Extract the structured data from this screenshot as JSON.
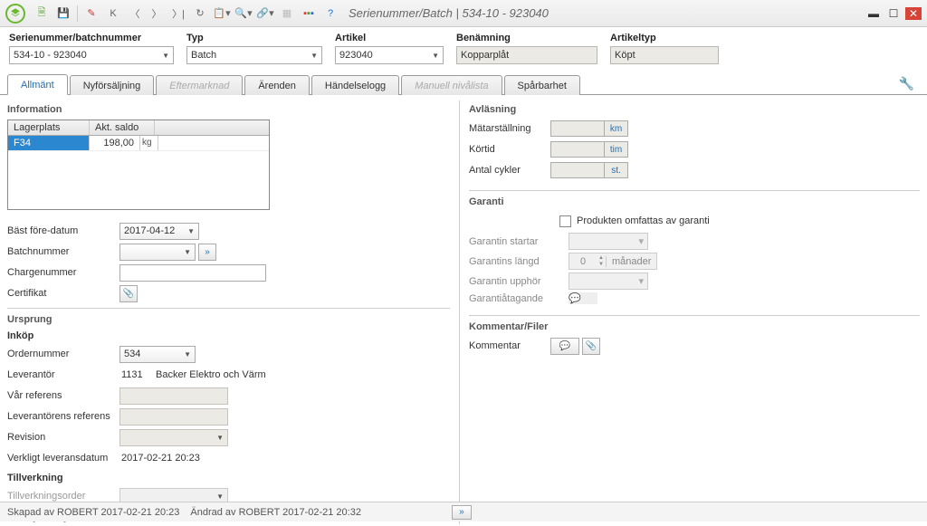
{
  "window": {
    "title": "Serienummer/Batch | 534-10 - 923040"
  },
  "header": {
    "serial_label": "Serienummer/batchnummer",
    "serial_value": "534-10 - 923040",
    "type_label": "Typ",
    "type_value": "Batch",
    "article_label": "Artikel",
    "article_value": "923040",
    "name_label": "Benämning",
    "name_value": "Kopparplåt",
    "arttype_label": "Artikeltyp",
    "arttype_value": "Köpt"
  },
  "tabs": {
    "t0": "Allmänt",
    "t1": "Nyförsäljning",
    "t2": "Eftermarknad",
    "t3": "Ärenden",
    "t4": "Händelselogg",
    "t5": "Manuell nivålista",
    "t6": "Spårbarhet"
  },
  "info": {
    "title": "Information",
    "col1": "Lagerplats",
    "col2": "Akt. saldo",
    "row1_place": "F34",
    "row1_qty": "198,00",
    "row1_unit": "kg",
    "best_before_label": "Bäst före-datum",
    "best_before_value": "2017-04-12",
    "batchnum_label": "Batchnummer",
    "chargenum_label": "Chargenummer",
    "cert_label": "Certifikat"
  },
  "origin": {
    "title": "Ursprung",
    "purchase_title": "Inköp",
    "order_label": "Ordernummer",
    "order_value": "534",
    "supplier_label": "Leverantör",
    "supplier_code": "1131",
    "supplier_name": "Backer Elektro och Värm",
    "ourref_label": "Vår referens",
    "supref_label": "Leverantörens referens",
    "revision_label": "Revision",
    "delivery_label": "Verkligt leveransdatum",
    "delivery_value": "2017-02-21 20:23",
    "mfg_title": "Tillverkning",
    "mfgorder_label": "Tillverkningsorder",
    "finished_label": "Verkligt färdigdatum"
  },
  "reading": {
    "title": "Avläsning",
    "meter_label": "Mätarställning",
    "meter_unit": "km",
    "runtime_label": "Körtid",
    "runtime_unit": "tim",
    "cycles_label": "Antal cykler",
    "cycles_unit": "st."
  },
  "warranty": {
    "title": "Garanti",
    "checkbox_label": "Produkten omfattas av garanti",
    "start_label": "Garantin startar",
    "length_label": "Garantins längd",
    "length_value": "0",
    "length_unit": "månader",
    "end_label": "Garantin upphör",
    "commit_label": "Garantiåtagande"
  },
  "comments": {
    "title": "Kommentar/Filer",
    "comment_label": "Kommentar"
  },
  "footer": {
    "created": "Skapad av ROBERT 2017-02-21 20:23",
    "modified": "Ändrad av ROBERT 2017-02-21 20:32"
  }
}
